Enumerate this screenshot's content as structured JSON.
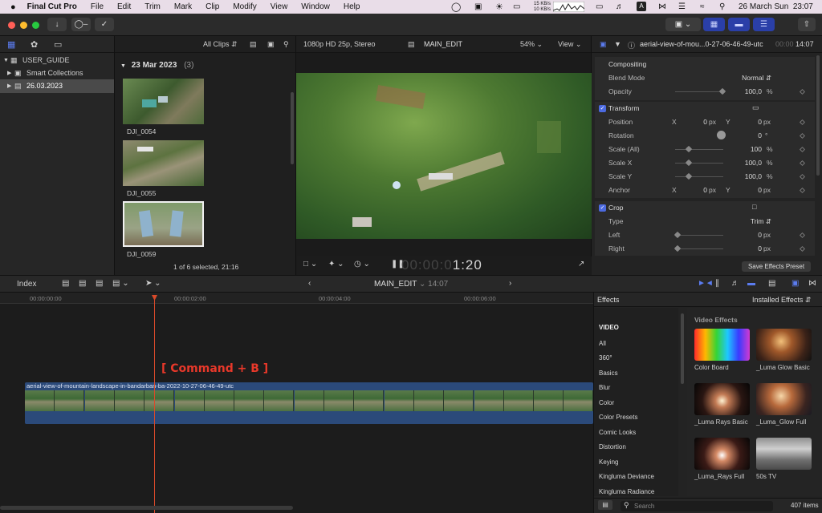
{
  "menubar": {
    "apple": "",
    "app": "Final Cut Pro",
    "items": [
      "File",
      "Edit",
      "Trim",
      "Mark",
      "Clip",
      "Modify",
      "View",
      "Window",
      "Help"
    ],
    "net_up": "15 KB/s",
    "net_down": "10 KB/s",
    "datetime": "26 March Sun  23:07"
  },
  "libraries": {
    "root": "USER_GUIDE",
    "smart_collections": "Smart Collections",
    "event": "26.03.2023"
  },
  "browser": {
    "filter": "All Clips",
    "group_date": "23 Mar 2023",
    "group_count": "(3)",
    "clips": [
      "DJI_0054",
      "DJI_0055",
      "DJI_0059"
    ],
    "status": "1 of 6 selected, 21:16"
  },
  "viewer": {
    "format": "1080p HD 25p, Stereo",
    "project": "MAIN_EDIT",
    "zoom": "54%",
    "view": "View",
    "timecode_dim": "00:00:0",
    "timecode": "1:20"
  },
  "inspector": {
    "clip_name": "aerial-view-of-mou...0-27-06-46-49-utc",
    "duration_dim": "00:00",
    "duration": "14:07",
    "compositing": "Compositing",
    "blend_mode_label": "Blend Mode",
    "blend_mode": "Normal",
    "opacity_label": "Opacity",
    "opacity": "100,0",
    "transform": "Transform",
    "position_label": "Position",
    "rotation_label": "Rotation",
    "scale_all_label": "Scale (All)",
    "scale_x_label": "Scale X",
    "scale_y_label": "Scale Y",
    "anchor_label": "Anchor",
    "x": "X",
    "y": "Y",
    "zero": "0",
    "px": "px",
    "pct": "%",
    "deg": "°",
    "scale_all": "100",
    "scale_x": "100,0",
    "scale_y": "100,0",
    "crop": "Crop",
    "type_label": "Type",
    "type": "Trim",
    "left_label": "Left",
    "right_label": "Right",
    "save_preset": "Save Effects Preset"
  },
  "timeline_bar": {
    "index": "Index",
    "project": "MAIN_EDIT",
    "duration": "14:07"
  },
  "timeline": {
    "ruler": [
      "00:00:00:00",
      "00:00:02:00",
      "00:00:04:00",
      "00:00:06:00"
    ],
    "annotation": "[ Command + B ]",
    "clip_name": "aerial-view-of-mountain-landscape-in-bandarban-ba-2022-10-27-06-46-49-utc"
  },
  "effects": {
    "title": "Effects",
    "installed": "Installed Effects",
    "video_heading": "VIDEO",
    "categories": [
      "All",
      "360°",
      "Basics",
      "Blur",
      "Color",
      "Color Presets",
      "Comic Looks",
      "Distortion",
      "Keying",
      "Kingluma Deviance",
      "Kingluma Radiance"
    ],
    "section": "Video Effects",
    "items": [
      "Color Board",
      "_Luma Glow Basic",
      "_Luma Rays Basic",
      "_Luma_Glow Full",
      "_Luma_Rays Full",
      "50s TV"
    ],
    "search_placeholder": "Search",
    "count": "407 items"
  },
  "colors": {
    "accent": "#4c6ae0",
    "playhead": "#d94a2a",
    "annotation": "#e8382a",
    "clip": "#2b4a7a"
  }
}
